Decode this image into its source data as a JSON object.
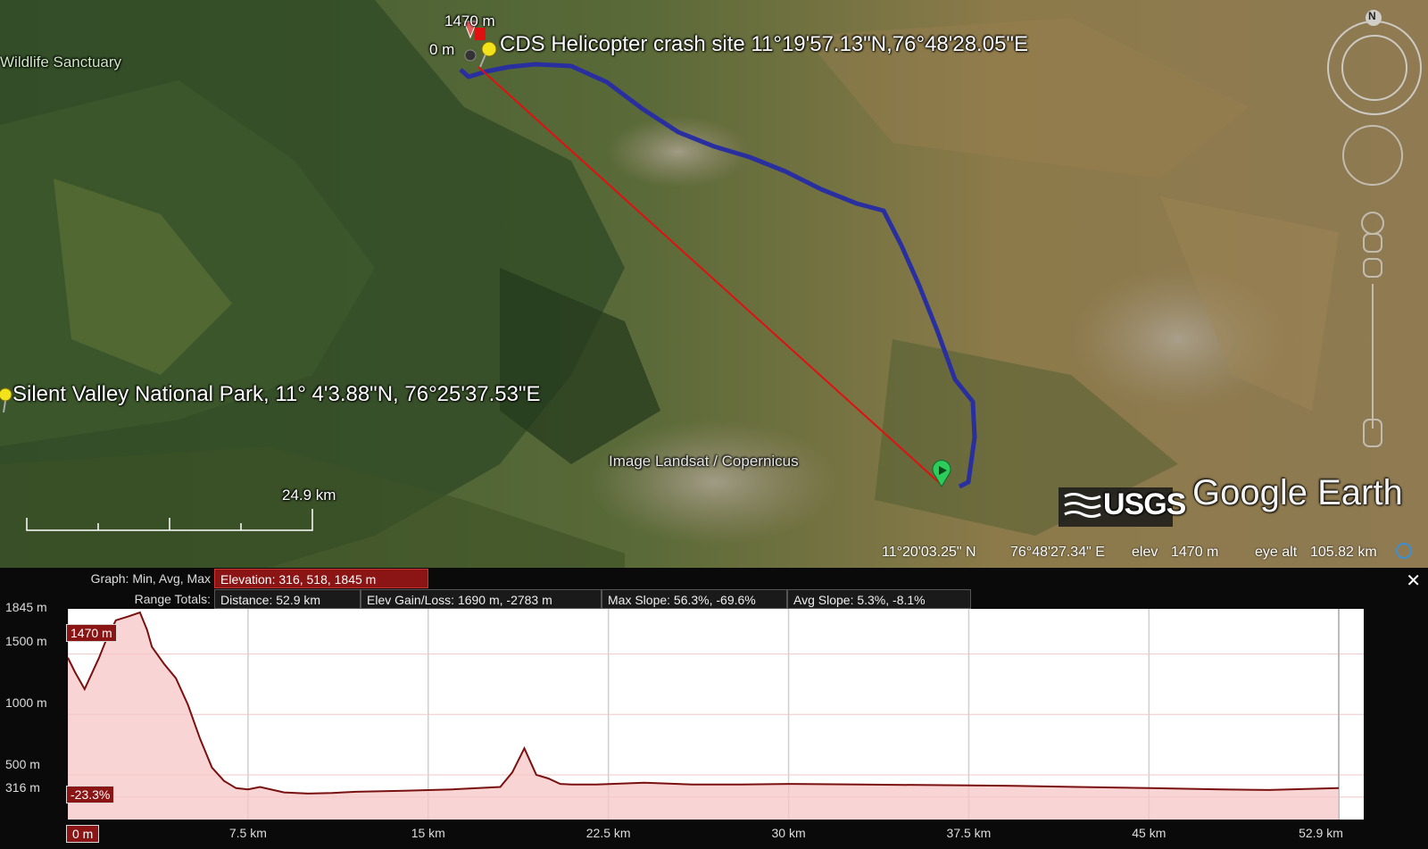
{
  "map": {
    "labels": {
      "sanctuary": "Wildlife Sanctuary",
      "crash_site": "CDS Helicopter crash site 11°19'57.13\"N,76°48'28.05\"E",
      "silent_valley": "Silent Valley National Park, 11° 4'3.88\"N, 76°25'37.53\"E",
      "imagery_credit": "Image Landsat / Copernicus",
      "start_elev": "1470 m",
      "start_dist": "0 m"
    },
    "scale_bar": "24.9 km",
    "logos": {
      "usgs": "USGS",
      "earth": "Google Earth"
    },
    "compass": "N",
    "colors": {
      "track": "#2a2fa0",
      "ruler_line": "#e01010",
      "placemark": "#f2e21c"
    }
  },
  "status": {
    "lat": "11°20'03.25\" N",
    "lon": "76°48'27.34\" E",
    "elev_label": "elev",
    "elev_value": "1470 m",
    "eye_label": "eye alt",
    "eye_value": "105.82 km"
  },
  "profile": {
    "graph_label": "Graph: Min, Avg, Max",
    "elevation": "Elevation: 316, 518, 1845 m",
    "range_label": "Range Totals:",
    "distance": "Distance: 52.9 km",
    "gain_loss": "Elev Gain/Loss: 1690 m, -2783 m",
    "max_slope": "Max Slope: 56.3%, -69.6%",
    "avg_slope": "Avg Slope: 5.3%, -8.1%",
    "cursor_elev": "1470 m",
    "cursor_slope": "-23.3%",
    "cursor_dist": "0 m",
    "close": "✕",
    "colors": {
      "line": "#7a1010",
      "fill": "#f6c5c5",
      "tag": "#8b1414"
    }
  },
  "chart_data": {
    "type": "area",
    "ylabels": [
      "1845 m",
      "1500 m",
      "1000 m",
      "500 m",
      "316 m"
    ],
    "xlabels": [
      "0 m",
      "7.5 km",
      "15 km",
      "22.5 km",
      "30 km",
      "37.5 km",
      "45 km",
      "52.9 km"
    ],
    "xlim": [
      0,
      52.9
    ],
    "ylim": [
      316,
      1845
    ],
    "x": [
      0,
      0.3,
      0.7,
      1.0,
      1.3,
      1.6,
      2.0,
      2.5,
      3.0,
      3.3,
      3.5,
      4.0,
      4.5,
      5.0,
      5.5,
      6.0,
      6.5,
      7.0,
      7.5,
      8.0,
      9.0,
      10.0,
      11.0,
      12.0,
      14.0,
      16.0,
      18.0,
      18.5,
      19.0,
      19.5,
      20.0,
      20.5,
      21.0,
      22.0,
      24.0,
      26.0,
      28.0,
      30.0,
      33.0,
      36.0,
      39.0,
      42.0,
      45.0,
      48.0,
      50.0,
      52.9
    ],
    "y": [
      1470,
      1350,
      1210,
      1340,
      1470,
      1620,
      1780,
      1810,
      1845,
      1700,
      1560,
      1420,
      1300,
      1080,
      800,
      560,
      450,
      390,
      380,
      400,
      355,
      345,
      350,
      360,
      368,
      380,
      400,
      520,
      720,
      500,
      470,
      425,
      420,
      420,
      435,
      420,
      420,
      425,
      420,
      415,
      410,
      400,
      390,
      380,
      375,
      390
    ]
  }
}
